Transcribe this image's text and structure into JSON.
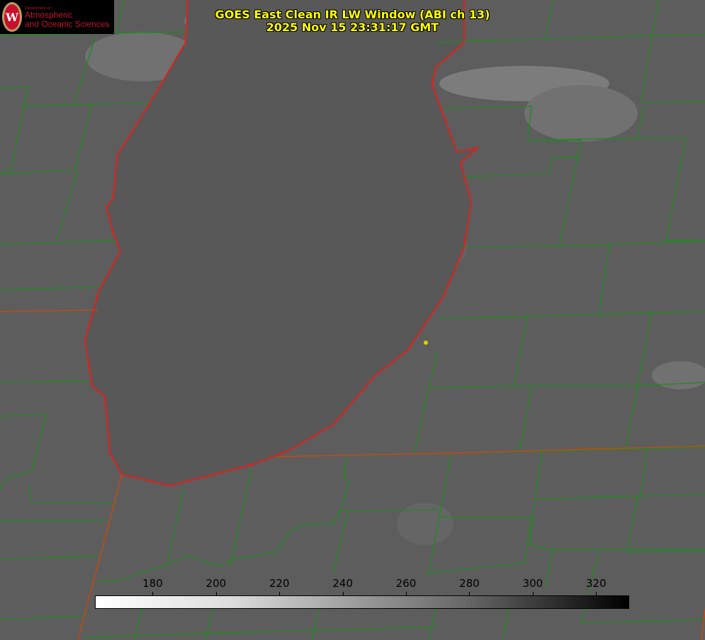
{
  "title": {
    "line1": "GOES East Clean IR LW Window (ABI ch 13)",
    "line2": "2025 Nov 15 23:31:17 GMT"
  },
  "logo": {
    "department": "Department of",
    "line1": "Atmospheric",
    "line2": "and Oceanic Sciences",
    "emblem": "W"
  },
  "colorbar": {
    "ticks": [
      "180",
      "200",
      "220",
      "240",
      "260",
      "280",
      "300",
      "320"
    ],
    "range": [
      162,
      330
    ],
    "colors": {
      "low": "#ffffff",
      "high": "#000000"
    }
  },
  "colors": {
    "background": "#5d5d5d",
    "county_lines": "#1f8a1f",
    "coastline": "#e0201a",
    "title": "#ffff00"
  }
}
